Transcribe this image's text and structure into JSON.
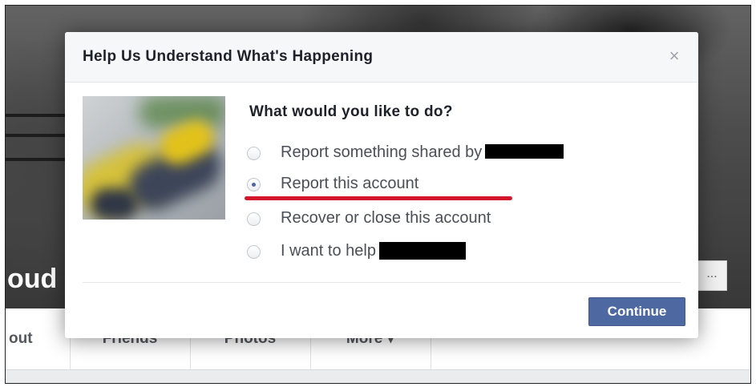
{
  "background": {
    "profile_name_fragment": "oud",
    "more_button_label": "...",
    "tabs": [
      {
        "label": "out"
      },
      {
        "label": "Friends"
      },
      {
        "label": "Photos"
      },
      {
        "label": "More ▾"
      }
    ]
  },
  "dialog": {
    "title": "Help Us Understand What's Happening",
    "close_icon": "×",
    "question": "What would you like to do?",
    "options": [
      {
        "label": "Report something shared by",
        "selected": false
      },
      {
        "label": "Report this account",
        "selected": true
      },
      {
        "label": "Recover or close this account",
        "selected": false
      },
      {
        "label": "I want to help",
        "selected": false
      }
    ],
    "continue_label": "Continue"
  },
  "colors": {
    "accent": "#4e69a2",
    "annotation_underline": "#d4172a"
  }
}
